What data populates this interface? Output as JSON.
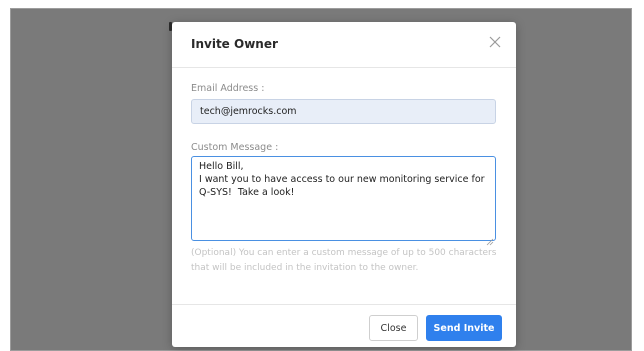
{
  "modal": {
    "title": "Invite Owner",
    "email_label": "Email Address :",
    "email_value": "tech@jemrocks.com",
    "message_label": "Custom Message :",
    "message_value": "Hello Bill,\nI want you to have access to our new monitoring service for Q-SYS!  Take a look!",
    "help_text": "(Optional) You can enter a custom message of up to 500 characters that will be included in the invitation to the owner.",
    "close_label": "Close",
    "send_label": "Send Invite"
  },
  "icons": {
    "close": "close-icon",
    "resize": "resize-grip-icon"
  },
  "colors": {
    "overlay": "#7a7a7a",
    "primary": "#2f80ed",
    "email_bg": "#e8eef8",
    "focus_border": "#4a90e2"
  }
}
